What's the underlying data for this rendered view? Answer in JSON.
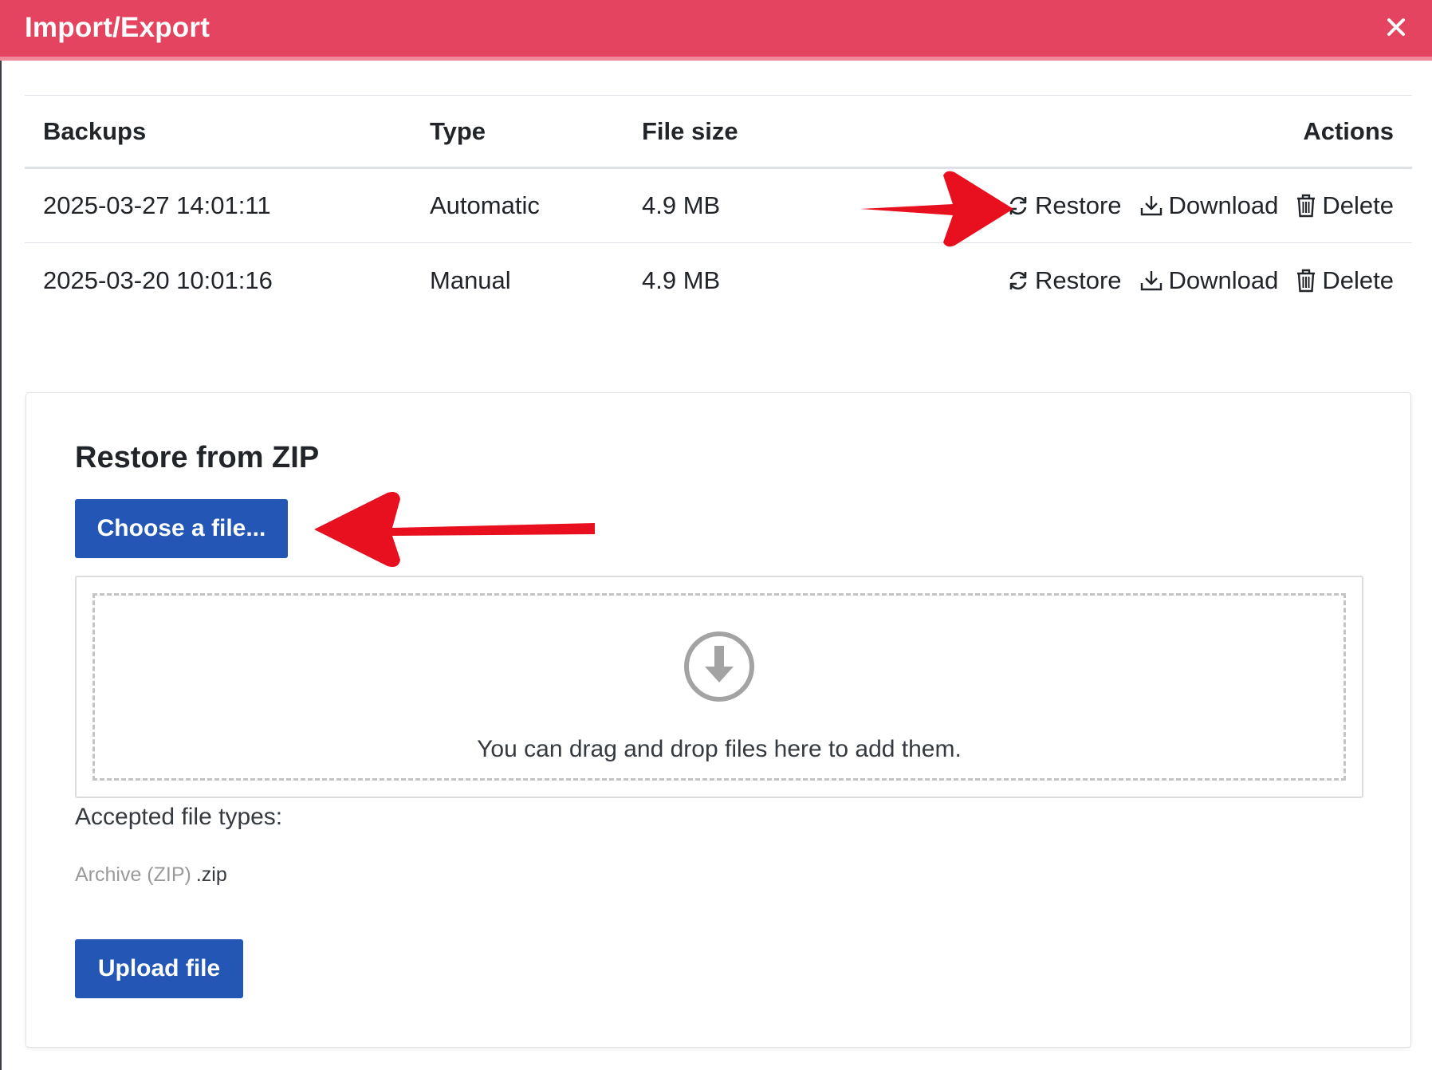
{
  "dialog": {
    "title": "Import/Export",
    "close_label": "×"
  },
  "backups_table": {
    "headers": {
      "backups": "Backups",
      "type": "Type",
      "file_size": "File size",
      "actions": "Actions"
    },
    "rows": [
      {
        "date": "2025-03-27 14:01:11",
        "type": "Automatic",
        "size": "4.9 MB"
      },
      {
        "date": "2025-03-20 10:01:16",
        "type": "Manual",
        "size": "4.9 MB"
      }
    ],
    "action_labels": {
      "restore": "Restore",
      "download": "Download",
      "delete": "Delete"
    }
  },
  "restore_section": {
    "heading": "Restore from ZIP",
    "choose_button": "Choose a file...",
    "dropzone_text": "You can drag and drop files here to add them.",
    "accepted_label": "Accepted file types:",
    "accepted_type_name": "Archive (ZIP)",
    "accepted_type_ext": ".zip",
    "upload_button": "Upload file"
  },
  "colors": {
    "titlebar": "#e4445f",
    "primary_button": "#2456b6",
    "annotation_arrow": "#e8101e"
  }
}
